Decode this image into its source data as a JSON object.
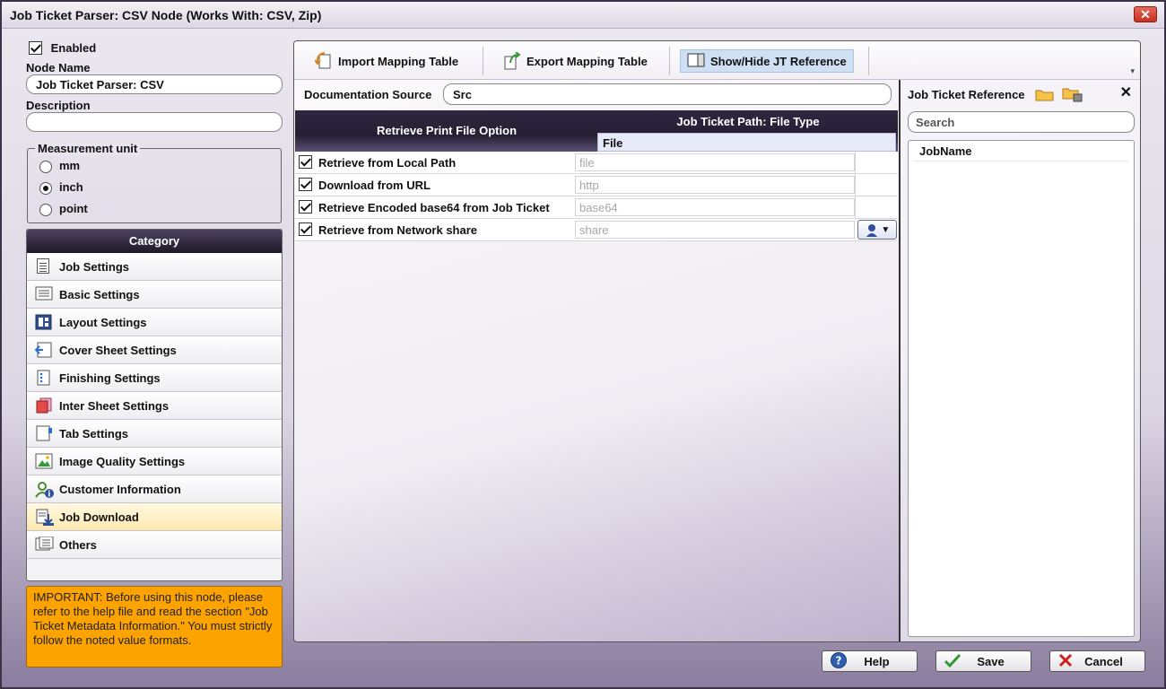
{
  "window": {
    "title": "Job Ticket Parser: CSV Node (Works With: CSV, Zip)"
  },
  "left": {
    "enabled_label": "Enabled",
    "enabled_checked": true,
    "node_name_label": "Node Name",
    "node_name_value": "Job Ticket Parser: CSV",
    "description_label": "Description",
    "description_value": "",
    "measurement": {
      "legend": "Measurement unit",
      "options": [
        "mm",
        "inch",
        "point"
      ],
      "selected": "inch"
    },
    "category": {
      "header": "Category",
      "items": [
        "Job Settings",
        "Basic Settings",
        "Layout Settings",
        "Cover Sheet Settings",
        "Finishing Settings",
        "Inter Sheet Settings",
        "Tab Settings",
        "Image Quality Settings",
        "Customer Information",
        "Job Download",
        "Others"
      ],
      "active": "Job Download"
    },
    "notice": "IMPORTANT: Before using this node, please refer to the help file and read the section \"Job Ticket Metadata Information.\" You must strictly follow the noted value formats."
  },
  "toolbar": {
    "import_label": "Import Mapping Table",
    "export_label": "Export Mapping Table",
    "showhide_label": "Show/Hide JT Reference"
  },
  "main": {
    "doc_source_label": "Documentation Source",
    "doc_source_value": "Src",
    "grid": {
      "col1_header": "Retrieve Print File Option",
      "col2_header": "Job Ticket Path: File Type",
      "col2_sub": "File",
      "rows": [
        {
          "label": "Retrieve from Local Path",
          "value": "file",
          "checked": true
        },
        {
          "label": "Download from URL",
          "value": "http",
          "checked": true
        },
        {
          "label": "Retrieve Encoded base64 from Job Ticket",
          "value": "base64",
          "checked": true
        },
        {
          "label": "Retrieve from Network share",
          "value": "share",
          "checked": true
        }
      ]
    }
  },
  "reference": {
    "title": "Job Ticket Reference",
    "search_placeholder": "Search",
    "items": [
      "JobName"
    ]
  },
  "buttons": {
    "help": "Help",
    "save": "Save",
    "cancel": "Cancel"
  },
  "colors": {
    "notice_bg": "#fca300",
    "header_dark": "#2f2640",
    "active_item": "#fde9b0"
  }
}
